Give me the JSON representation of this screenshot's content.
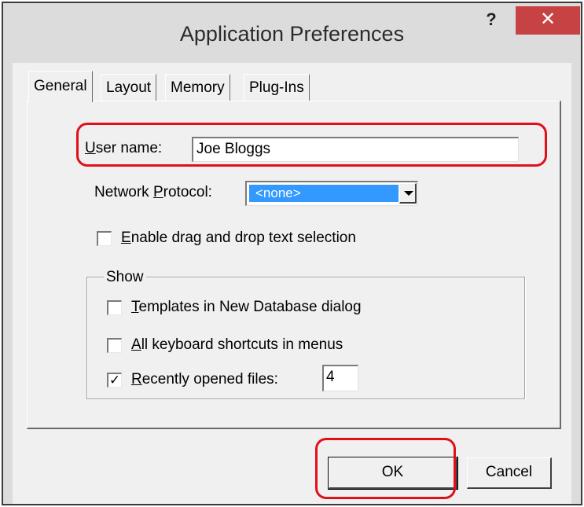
{
  "window": {
    "title": "Application Preferences",
    "help_label": "?",
    "close_label": "✕"
  },
  "tabs": [
    {
      "label": "General",
      "active": true
    },
    {
      "label": "Layout",
      "active": false
    },
    {
      "label": "Memory",
      "active": false
    },
    {
      "label": "Plug-Ins",
      "active": false
    }
  ],
  "general": {
    "user_name_prefix": "U",
    "user_name_rest": "ser name:",
    "user_name_value": "Joe Bloggs",
    "protocol_prefix": "Network ",
    "protocol_accel": "P",
    "protocol_rest": "rotocol:",
    "protocol_value": "<none>",
    "drag_accel": "E",
    "drag_rest": "nable drag and drop text selection",
    "drag_checked": false
  },
  "show_group": {
    "label": "Show",
    "templates_accel": "T",
    "templates_rest": "emplates in New Database dialog",
    "templates_checked": false,
    "shortcuts_accel": "A",
    "shortcuts_rest": "ll keyboard shortcuts in menus",
    "shortcuts_checked": false,
    "recent_accel": "R",
    "recent_rest": "ecently opened files:",
    "recent_checked": true,
    "recent_count": "4",
    "check_mark": "✓"
  },
  "buttons": {
    "ok_label": "OK",
    "cancel_label": "Cancel"
  },
  "colors": {
    "highlight": "#e0101a",
    "selection": "#3399ff",
    "close_button": "#c74343"
  }
}
